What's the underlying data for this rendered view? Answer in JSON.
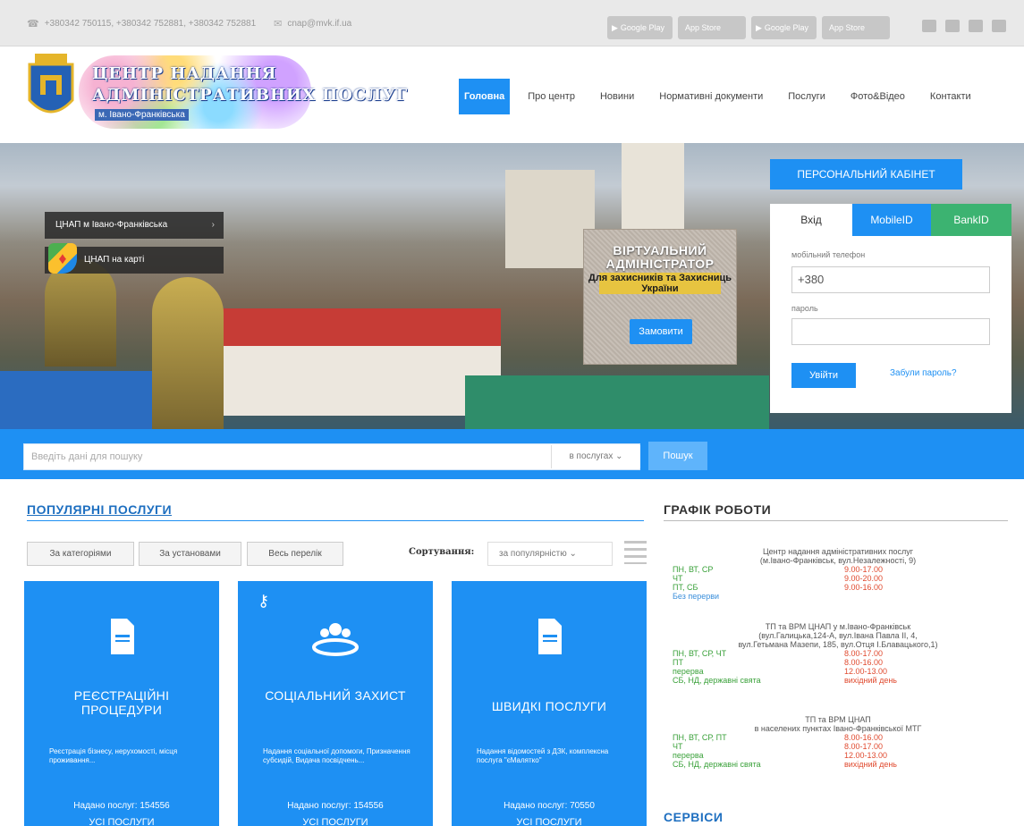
{
  "topbar": {
    "phones": "+380342 750115, +380342 752881, +380342 752881",
    "email": "cnap@mvk.if.ua",
    "stores": [
      "Google Play",
      "App Store",
      "Google Play",
      "App Store"
    ]
  },
  "logo": {
    "line1": "ЦЕНТР НАДАННЯ",
    "line2": "АДМІНІСТРАТИВНИХ ПОСЛУГ",
    "line3": "м. Івано-Франківська"
  },
  "nav": [
    "Головна",
    "Про центр",
    "Новини",
    "Нормативні документи",
    "Послуги",
    "Фото&Відео",
    "Контакти"
  ],
  "hero": {
    "pill1": "ЦНАП м Івано-Франківська",
    "pill2": "ЦНАП на карті",
    "admin_title": "ВІРТУАЛЬНИЙ АДМІНІСТРАТОР",
    "admin_sub": "Для захисників та Захисниць України",
    "admin_btn": "Замовити"
  },
  "cabinet": {
    "title": "ПЕРСОНАЛЬНИЙ КАБІНЕТ",
    "tab_login": "Вхід",
    "tab_mobile": "MobileID",
    "tab_bank": "BankID",
    "phone_label": "мобільний телефон",
    "phone_value": "+380",
    "pass_label": "пароль",
    "login_btn": "Увійти",
    "forgot": "Забули пароль?"
  },
  "search": {
    "placeholder": "Введіть дані для пошуку",
    "scope": "в послугах",
    "button": "Пошук"
  },
  "popular": {
    "title": "ПОПУЛЯРНІ ПОСЛУГИ",
    "filters": [
      "За категоріями",
      "За установами",
      "Весь перелік"
    ],
    "sort_label": "Сортування:",
    "sort_value": "за популярністю",
    "cards": [
      {
        "title": "РЕЄСТРАЦІЙНІ ПРОЦЕДУРИ",
        "desc": "Реєстрація бізнесу, нерухомості, місця проживання...",
        "count": "Надано послуг: 154556",
        "all": "УСІ ПОСЛУГИ"
      },
      {
        "title": "СОЦІАЛЬНИЙ ЗАХИСТ",
        "desc": "Надання соціальної допомоги, Призначення субсидій, Видача посвідчень...",
        "count": "Надано послуг: 154556",
        "all": "УСІ ПОСЛУГИ"
      },
      {
        "title": "ШВИДКІ ПОСЛУГИ",
        "desc": "Надання відомостей з ДЗК, комплексна послуга \"єМалятко\"",
        "count": "Надано послуг: 70550",
        "all": "УСІ ПОСЛУГИ"
      }
    ]
  },
  "schedule": {
    "title": "ГРАФІК РОБОТИ",
    "block1": {
      "head1": "Центр надання адміністративних послуг",
      "head2": "(м.Івано-Франківськ, вул.Незалежності, 9)",
      "rows": [
        {
          "d": "ПН, ВТ, СР",
          "t": "9.00-17.00"
        },
        {
          "d": "ЧТ",
          "t": "9.00-20.00"
        },
        {
          "d": "ПТ, СБ",
          "t": "9.00-16.00"
        }
      ],
      "note": "Без перерви"
    },
    "block2": {
      "head1": "ТП та ВРМ ЦНАП у м.Івано-Франківськ",
      "head2": "(вул.Галицька,124-А, вул.Івана Павла ІІ, 4,",
      "head3": "вул.Гетьмана Мазепи, 185, вул.Отця І.Блавацького,1)",
      "rows": [
        {
          "d": "ПН, ВТ, СР, ЧТ",
          "t": "8.00-17.00"
        },
        {
          "d": "ПТ",
          "t": "8.00-16.00"
        },
        {
          "d": "перерва",
          "t": "12.00-13.00"
        },
        {
          "d": "СБ, НД, державні свята",
          "t": "вихідний день"
        }
      ]
    },
    "block3": {
      "head1": "ТП та ВРМ ЦНАП",
      "head2": "в населених пунктах Івано-Франківської МТГ",
      "rows": [
        {
          "d": "ПН, ВТ, СР, ПТ",
          "t": "8.00-16.00"
        },
        {
          "d": "ЧТ",
          "t": "8.00-17.00"
        },
        {
          "d": "перерва",
          "t": "12.00-13.00"
        },
        {
          "d": "СБ, НД, державні свята",
          "t": "вихідний день"
        }
      ]
    }
  },
  "services": {
    "title": "СЕРВІСИ"
  }
}
